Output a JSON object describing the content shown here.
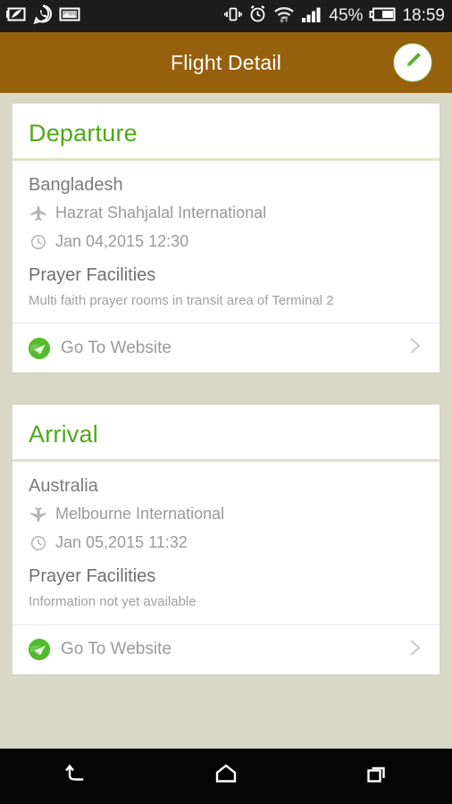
{
  "status_bar": {
    "left_icons": [
      "note-feather-icon",
      "whatsapp-icon",
      "screenshot-image-icon"
    ],
    "right_icons": [
      "vibrate-icon",
      "alarm-clock-icon",
      "wifi-icon",
      "signal-bars-icon",
      "battery-icon"
    ],
    "battery_percent": "45%",
    "time": "18:59"
  },
  "app_bar": {
    "title": "Flight Detail",
    "edit_icon": "pencil-edit-icon",
    "brand_brown": "#96600d",
    "accent_green": "#4fa91a"
  },
  "cards": [
    {
      "section_title": "Departure",
      "country": "Bangladesh",
      "airport_icon": "airplane-takeoff-icon",
      "airport": "Hazrat Shahjalal International",
      "time_icon": "clock-icon",
      "datetime": "Jan 04,2015  12:30",
      "facility_label": "Prayer Facilities",
      "facility_text": "Multi faith prayer rooms in transit area of Terminal 2",
      "website_icon": "globe-website-icon",
      "website_label": "Go To Website",
      "chevron_icon": "chevron-right-icon"
    },
    {
      "section_title": "Arrival",
      "country": "Australia",
      "airport_icon": "airplane-landing-icon",
      "airport": "Melbourne International",
      "time_icon": "clock-icon",
      "datetime": "Jan 05,2015  11:32",
      "facility_label": "Prayer Facilities",
      "facility_text": "Information not yet available",
      "website_icon": "globe-website-icon",
      "website_label": "Go To Website",
      "chevron_icon": "chevron-right-icon"
    }
  ],
  "nav_bar": {
    "buttons": [
      "back-icon",
      "home-icon",
      "recents-icon"
    ]
  }
}
